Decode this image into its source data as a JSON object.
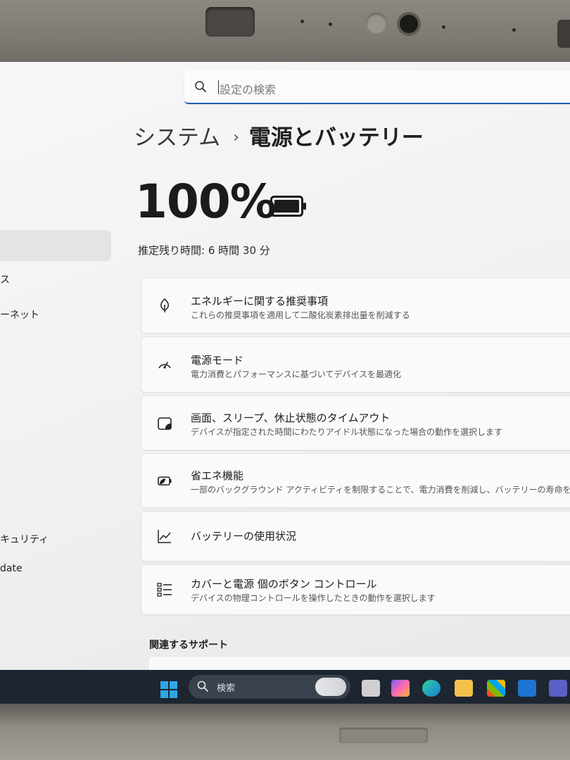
{
  "search": {
    "placeholder": "設定の検索"
  },
  "breadcrumb": {
    "parent": "システム",
    "separator": "›",
    "current": "電源とバッテリー"
  },
  "battery": {
    "percent": "100%",
    "level": 1.0,
    "remaining": "推定残り時間: 6 時間 30 分"
  },
  "sidebar": {
    "items": [
      {
        "label": "ス"
      },
      {
        "label": "ーネット"
      },
      {
        "label": "キュリティ"
      },
      {
        "label": "date"
      }
    ]
  },
  "cards": [
    {
      "icon": "leaf-icon",
      "title": "エネルギーに関する推奨事項",
      "description": "これらの推奨事項を適用して二酸化炭素排出量を削減する"
    },
    {
      "icon": "power-mode-icon",
      "title": "電源モード",
      "description": "電力消費とパフォーマンスに基づいてデバイスを最適化"
    },
    {
      "icon": "screen-timeout-icon",
      "title": "画面、スリープ、休止状態のタイムアウト",
      "description": "デバイスが指定された時間にわたりアイドル状態になった場合の動作を選択します"
    },
    {
      "icon": "energy-saver-icon",
      "title": "省エネ機能",
      "description": "一部のバックグラウンド アクティビティを制限することで、電力消費を削減し、バッテリーの寿命を延ばす"
    },
    {
      "icon": "battery-usage-icon",
      "title": "バッテリーの使用状況",
      "description": ""
    },
    {
      "icon": "lid-button-icon",
      "title": "カバーと電源 個のボタン コントロール",
      "description": "デバイスの物理コントロールを操作したときの動作を選択します"
    }
  ],
  "related": {
    "title": "関連するサポート"
  },
  "taskbar": {
    "search_label": "検索"
  },
  "colors": {
    "accent": "#1d5fb0",
    "taskbar": "#1d2630"
  }
}
